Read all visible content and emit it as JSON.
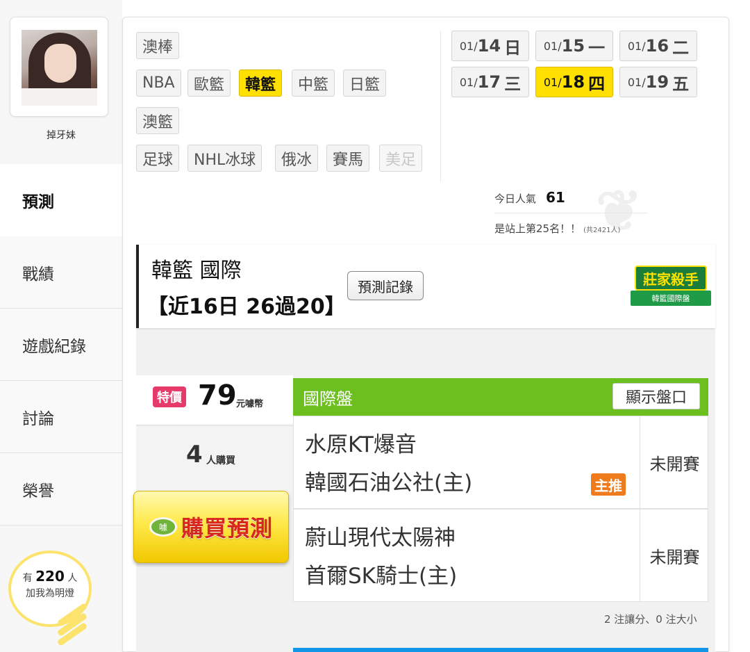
{
  "sidebar": {
    "username": "掉牙妹",
    "nav": [
      "預測",
      "戰績",
      "遊戲紀錄",
      "討論",
      "榮譽"
    ],
    "active_nav": "預測",
    "fans": {
      "prefix": "有",
      "count": "220",
      "suffix": "人",
      "line2": "加我為明燈"
    }
  },
  "sports": {
    "row1": [
      "澳棒"
    ],
    "row2": [
      "NBA",
      "歐籃",
      "韓籃",
      "中籃",
      "日籃"
    ],
    "row3": [
      "澳籃"
    ],
    "row4": [
      "足球",
      "NHL冰球",
      "俄冰",
      "賽馬",
      "美足"
    ],
    "active": "韓籃",
    "disabled": "美足"
  },
  "dates": [
    {
      "md": "01/",
      "day": "14",
      "wd": "日"
    },
    {
      "md": "01/",
      "day": "15",
      "wd": "一"
    },
    {
      "md": "01/",
      "day": "16",
      "wd": "二"
    },
    {
      "md": "01/",
      "day": "17",
      "wd": "三"
    },
    {
      "md": "01/",
      "day": "18",
      "wd": "四",
      "active": true
    },
    {
      "md": "01/",
      "day": "19",
      "wd": "五"
    }
  ],
  "popularity": {
    "label": "今日人氣",
    "value": "61",
    "rank_text": "是站上第25名！！",
    "total": "(共2421人)"
  },
  "league": {
    "title": "韓籃 國際",
    "record": "【近16日 26過20】",
    "history_button": "預測記錄",
    "badge_main": "莊家殺手",
    "badge_sub": "韓籃國際盤"
  },
  "offer": {
    "special_label": "特價",
    "price": "79",
    "unit": "元噱幣",
    "buyers": "4",
    "buyers_unit": "人購買",
    "buy_button": "購買預測",
    "coin_label": "噱"
  },
  "pan": {
    "title": "國際盤",
    "show_button": "顯示盤口",
    "matches": [
      {
        "away": "水原KT爆音",
        "home": "韓國石油公社(主)",
        "status": "未開賽",
        "main_pick": "主推"
      },
      {
        "away": "蔚山現代太陽神",
        "home": "首爾SK騎士(主)",
        "status": "未開賽"
      }
    ],
    "summary": "2 注讓分、0 注大小"
  },
  "colors": {
    "accent_yellow": "#ffe000",
    "pan_green": "#6bbf1e",
    "special_pink": "#e63b6a",
    "main_pick_orange": "#f07b1c",
    "buy_red": "#d7261c"
  }
}
